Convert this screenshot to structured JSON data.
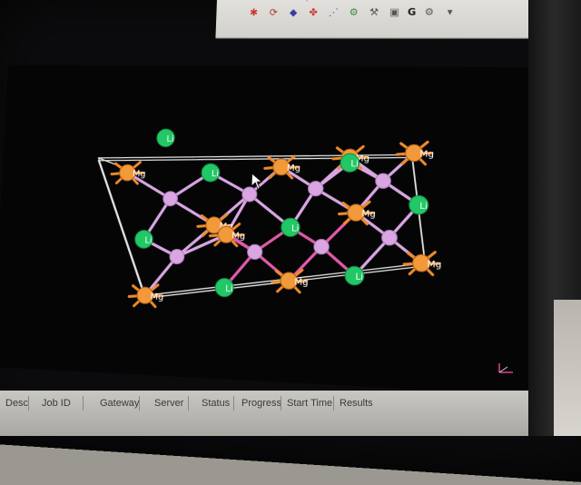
{
  "toolbar": {
    "row1_icons": [
      "graph-icon",
      "cube-icon",
      "color-icon",
      "select-icon",
      "display-icon"
    ],
    "row2_icons": [
      "rotate-icon",
      "list-icon",
      "grid-icon",
      "atoms-icon",
      "bond-icon",
      "measure-icon",
      "view-icon",
      "zoom-icon"
    ],
    "g_label": "G"
  },
  "viewport": {
    "atom_labels": {
      "li": "Li",
      "mg": "Mg"
    }
  },
  "status_bar": {
    "columns": [
      "Description",
      "Job ID",
      "Gateway",
      "Server",
      "Status",
      "Progress",
      "Start Time",
      "Results ..."
    ]
  },
  "colors": {
    "background": "#050506",
    "li_atom": "#22c766",
    "mg_atom": "#f29a3a",
    "other_atom": "#d9a6e2",
    "unit_cell": "#e6e6e6",
    "bond_orange": "#ef8b2a",
    "bond_pink": "#e05aa8"
  }
}
